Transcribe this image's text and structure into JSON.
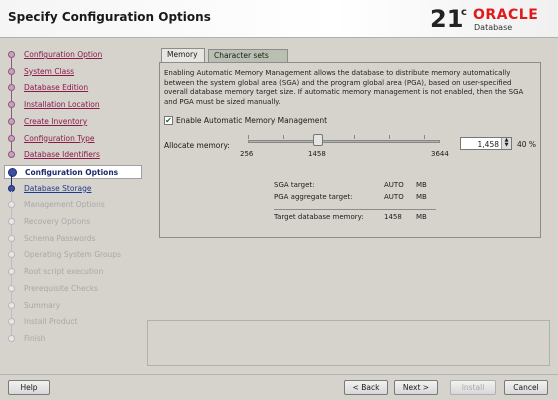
{
  "header": {
    "title": "Specify Configuration Options",
    "logo": {
      "version": "21",
      "suffix": "c",
      "brand": "ORACLE",
      "product": "Database"
    }
  },
  "sidebar": {
    "steps": [
      {
        "label": "Configuration Option",
        "state": "done"
      },
      {
        "label": "System Class",
        "state": "done"
      },
      {
        "label": "Database Edition",
        "state": "done"
      },
      {
        "label": "Installation Location",
        "state": "done"
      },
      {
        "label": "Create Inventory",
        "state": "done"
      },
      {
        "label": "Configuration Type",
        "state": "done"
      },
      {
        "label": "Database Identifiers",
        "state": "done"
      },
      {
        "label": "Configuration Options",
        "state": "current"
      },
      {
        "label": "Database Storage",
        "state": "next"
      },
      {
        "label": "Management Options",
        "state": "future"
      },
      {
        "label": "Recovery Options",
        "state": "future"
      },
      {
        "label": "Schema Passwords",
        "state": "future"
      },
      {
        "label": "Operating System Groups",
        "state": "future"
      },
      {
        "label": "Root script execution",
        "state": "future"
      },
      {
        "label": "Prerequisite Checks",
        "state": "future"
      },
      {
        "label": "Summary",
        "state": "future"
      },
      {
        "label": "Install Product",
        "state": "future"
      },
      {
        "label": "Finish",
        "state": "future"
      }
    ]
  },
  "main": {
    "tabs": [
      {
        "label": "Memory",
        "active": true
      },
      {
        "label": "Character sets",
        "active": false
      }
    ],
    "description": "Enabling Automatic Memory Management allows the database to distribute memory automatically between the system global area (SGA) and the program global area (PGA), based on user-specified overall database memory target size. If automatic memory management is not enabled, then the SGA and PGA must be sized manually.",
    "amm": {
      "label": "Enable Automatic Memory Management",
      "checked": true
    },
    "allocate": {
      "label": "Allocate memory:",
      "min": "256",
      "mid": "1458",
      "max": "3644",
      "value": "1,458",
      "percent": "40 %"
    },
    "memory": [
      {
        "key": "SGA target:",
        "value": "AUTO",
        "unit": "MB"
      },
      {
        "key": "PGA aggregate target:",
        "value": "AUTO",
        "unit": "MB"
      },
      {
        "key": "Target database memory:",
        "value": "1458",
        "unit": "MB"
      }
    ]
  },
  "footer": {
    "help": "Help",
    "back": "< Back",
    "next": "Next >",
    "install": "Install",
    "cancel": "Cancel"
  },
  "colors": {
    "brand": "#e01a1a",
    "current_step": "#3c4fa0",
    "done_link": "#8a1a4a"
  }
}
